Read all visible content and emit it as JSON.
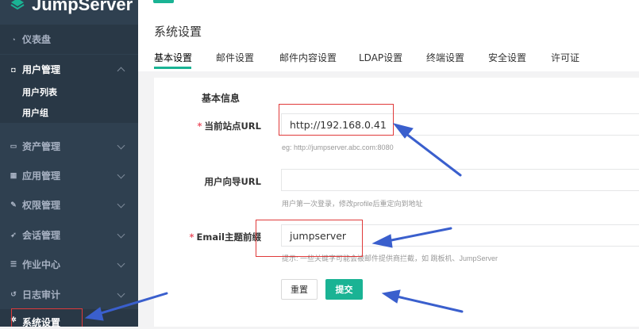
{
  "brand": {
    "name": "JumpServer"
  },
  "sidebar": {
    "items": [
      {
        "label": "仪表盘",
        "icon": "dashboard-icon"
      },
      {
        "label": "用户管理",
        "icon": "users-icon"
      },
      {
        "label": "资产管理",
        "icon": "desktop-icon"
      },
      {
        "label": "应用管理",
        "icon": "grid-icon"
      },
      {
        "label": "权限管理",
        "icon": "edit-icon"
      },
      {
        "label": "会话管理",
        "icon": "rocket-icon"
      },
      {
        "label": "作业中心",
        "icon": "task-icon"
      },
      {
        "label": "日志审计",
        "icon": "history-icon"
      },
      {
        "label": "系统设置",
        "icon": "cogs-icon"
      }
    ],
    "user_sub": [
      "用户列表",
      "用户组"
    ]
  },
  "page": {
    "title": "系统设置"
  },
  "tabs": [
    "基本设置",
    "邮件设置",
    "邮件内容设置",
    "LDAP设置",
    "终端设置",
    "安全设置",
    "许可证"
  ],
  "form": {
    "section_title": "基本信息",
    "site_url": {
      "label": "当前站点URL",
      "value": "http://192.168.0.41",
      "help": "eg: http://jumpserver.abc.com:8080"
    },
    "user_guide_url": {
      "label": "用户向导URL",
      "value": "",
      "help": "用户第一次登录，修改profile后重定向到地址"
    },
    "email_subject_prefix": {
      "label": "Email主题前缀",
      "value": "jumpserver",
      "help": "提示: 一些关键字可能会被邮件提供商拦截，如 跳板机、JumpServer"
    },
    "reset_label": "重置",
    "submit_label": "提交"
  },
  "colors": {
    "accent": "#1ab394",
    "sidebar_bg": "#2f4050",
    "annotation": "#3a5fcd",
    "highlight": "#e03a3a"
  }
}
